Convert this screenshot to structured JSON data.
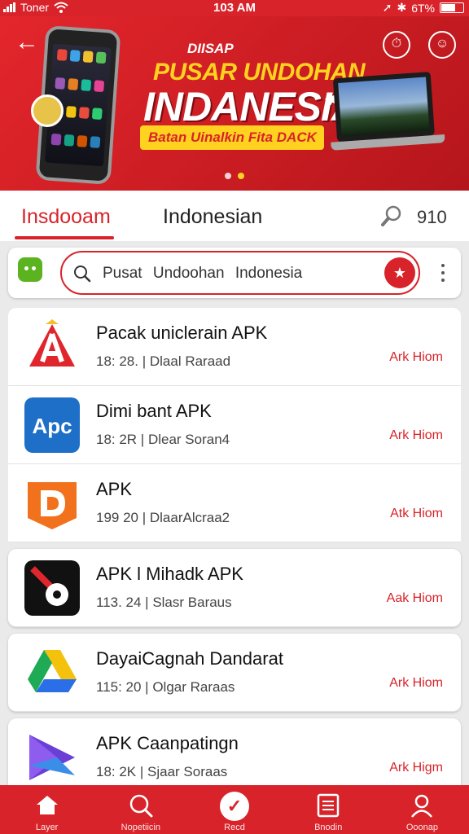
{
  "status_bar": {
    "carrier": "Toner",
    "time": "103 AM",
    "battery": "6T%"
  },
  "banner": {
    "subtitle1": "DIISAP",
    "subtitle2": "PUSAR UNDOHAN",
    "title": "INDANESIA",
    "tag_main": "Batan Uinalkin",
    "tag_accent": "Fita DACK",
    "accent_color": "#d8232a",
    "highlight_color": "#ffd21f"
  },
  "tabs": {
    "active_label": "Insdooam",
    "second_label": "Indonesian",
    "count": "910"
  },
  "search": {
    "value": "Pusat Undoohan Indonesia"
  },
  "apps": [
    {
      "name": "Pacak uniclerain APK",
      "meta": "18: 28. | Dlaal Raraad",
      "action": "Ark Hiom",
      "icon": "red-a-app-icon"
    },
    {
      "name": "Dimi bant APK",
      "meta": "18: 2R | Dlear Soran4",
      "action": "Ark Hiom",
      "icon": "apc-app-icon"
    },
    {
      "name": "APK",
      "meta": "199 20 | DlaarAlcraa2",
      "action": "Atk Hiom",
      "icon": "d-app-icon"
    },
    {
      "name": "APK l Mihadk APK",
      "meta": "113. 24 | Slasr Baraus",
      "action": "Aak Hiom",
      "icon": "b-app-icon"
    },
    {
      "name": "DayaiCagnah Dandarat",
      "meta": "115: 20 | Olgar Raraas",
      "action": "Ark Hiom",
      "icon": "drive-app-icon"
    },
    {
      "name": "APK Caanpatingn",
      "meta": "18: 2K | Sjaar Soraas",
      "action": "Ark Higm",
      "icon": "purple-app-icon"
    }
  ],
  "bottom_nav": [
    {
      "label": "Layer",
      "icon": "home-icon"
    },
    {
      "label": "Nopetiicin",
      "icon": "search-icon"
    },
    {
      "label": "Recd",
      "icon": "check-icon"
    },
    {
      "label": "Bnodin",
      "icon": "list-icon"
    },
    {
      "label": "Ooonap",
      "icon": "user-icon"
    }
  ]
}
